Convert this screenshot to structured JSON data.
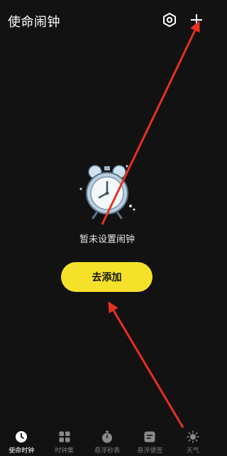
{
  "header": {
    "title": "使命闹钟",
    "settings_icon": "hexagon-settings-icon",
    "add_icon": "plus-icon"
  },
  "empty_state": {
    "illustration": "alarm-clock-illustration",
    "message": "暂未设置闹钟",
    "action_label": "去添加"
  },
  "tabs": [
    {
      "label": "使命时钟",
      "icon": "clock-icon",
      "active": true
    },
    {
      "label": "时钟集",
      "icon": "grid-icon",
      "active": false
    },
    {
      "label": "悬浮秒表",
      "icon": "stopwatch-icon",
      "active": false
    },
    {
      "label": "悬浮便签",
      "icon": "note-icon",
      "active": false
    },
    {
      "label": "天气",
      "icon": "sun-icon",
      "active": false
    }
  ],
  "colors": {
    "background": "#121212",
    "accent": "#f5e12a",
    "annotation_arrow": "#e8301f"
  }
}
